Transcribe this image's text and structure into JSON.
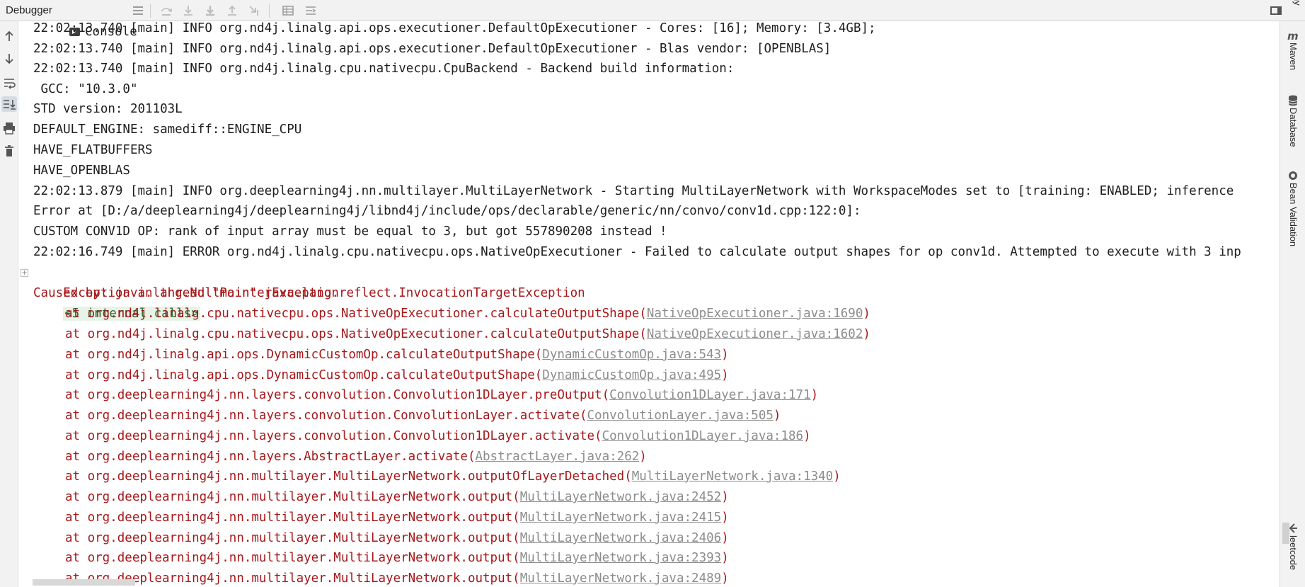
{
  "toolbar": {
    "tabs": [
      {
        "label": "Debugger",
        "icon": "none"
      },
      {
        "label": "Console",
        "icon": "console-icon"
      }
    ],
    "icons": [
      "menu-lines-icon",
      "step-over-icon",
      "step-into-icon",
      "force-step-into-icon",
      "step-out-icon",
      "run-to-cursor-icon",
      "evaluate-table-icon",
      "trace-icon",
      "restore-layout-icon"
    ]
  },
  "left_toolbar": {
    "buttons": [
      "up-arrow-icon",
      "down-arrow-icon",
      "soft-wrap-icon",
      "scroll-to-end-icon",
      "print-icon",
      "trash-icon"
    ],
    "active": "scroll-to-end-icon"
  },
  "right_toolbar": {
    "cut_label": "ny",
    "tabs": [
      {
        "label": "Maven",
        "icon": "maven-icon"
      },
      {
        "label": "Database",
        "icon": "database-icon"
      },
      {
        "label": "Bean Validation",
        "icon": "bean-icon"
      },
      {
        "label": "leetcode",
        "icon": "leetcode-icon"
      }
    ]
  },
  "console": {
    "lines": [
      {
        "type": "info",
        "text": "22:02:13.740 [main] INFO org.nd4j.linalg.api.ops.executioner.DefaultOpExecutioner - Cores: [16]; Memory: [3.4GB];"
      },
      {
        "type": "info",
        "text": "22:02:13.740 [main] INFO org.nd4j.linalg.api.ops.executioner.DefaultOpExecutioner - Blas vendor: [OPENBLAS]"
      },
      {
        "type": "info",
        "text": "22:02:13.740 [main] INFO org.nd4j.linalg.cpu.nativecpu.CpuBackend - Backend build information:"
      },
      {
        "type": "info",
        "text": " GCC: \"10.3.0\""
      },
      {
        "type": "info",
        "text": "STD version: 201103L"
      },
      {
        "type": "info",
        "text": "DEFAULT_ENGINE: samediff::ENGINE_CPU"
      },
      {
        "type": "info",
        "text": "HAVE_FLATBUFFERS"
      },
      {
        "type": "info",
        "text": "HAVE_OPENBLAS"
      },
      {
        "type": "info",
        "text": "22:02:13.879 [main] INFO org.deeplearning4j.nn.multilayer.MultiLayerNetwork - Starting MultiLayerNetwork with WorkspaceModes set to [training: ENABLED; inference"
      },
      {
        "type": "info",
        "text": "Error at [D:/a/deeplearning4j/deeplearning4j/libnd4j/include/ops/declarable/generic/nn/convo/conv1d.cpp:122:0]:"
      },
      {
        "type": "info",
        "text": "CUSTOM CONV1D OP: rank of input array must be equal to 3, but got 557890208 instead !"
      },
      {
        "type": "info",
        "text": "22:02:16.749 [main] ERROR org.nd4j.linalg.cpu.nativecpu.ops.NativeOpExecutioner - Failed to calculate output shapes for op conv1d. Attempted to execute with 3 inp"
      }
    ],
    "exception": {
      "text": "Exception in thread \"main\" java.lang.reflect.InvocationTargetException",
      "badge": "<5 internal calls>",
      "fold": "+"
    },
    "caused_by": "Caused by: java.lang.NullPointerException",
    "stack": [
      {
        "prefix": "at org.nd4j.linalg.cpu.nativecpu.ops.NativeOpExecutioner.calculateOutputShape(",
        "link": "NativeOpExecutioner.java:1690",
        "suffix": ")"
      },
      {
        "prefix": "at org.nd4j.linalg.cpu.nativecpu.ops.NativeOpExecutioner.calculateOutputShape(",
        "link": "NativeOpExecutioner.java:1602",
        "suffix": ")"
      },
      {
        "prefix": "at org.nd4j.linalg.api.ops.DynamicCustomOp.calculateOutputShape(",
        "link": "DynamicCustomOp.java:543",
        "suffix": ")"
      },
      {
        "prefix": "at org.nd4j.linalg.api.ops.DynamicCustomOp.calculateOutputShape(",
        "link": "DynamicCustomOp.java:495",
        "suffix": ")"
      },
      {
        "prefix": "at org.deeplearning4j.nn.layers.convolution.Convolution1DLayer.preOutput(",
        "link": "Convolution1DLayer.java:171",
        "suffix": ")"
      },
      {
        "prefix": "at org.deeplearning4j.nn.layers.convolution.ConvolutionLayer.activate(",
        "link": "ConvolutionLayer.java:505",
        "suffix": ")"
      },
      {
        "prefix": "at org.deeplearning4j.nn.layers.convolution.Convolution1DLayer.activate(",
        "link": "Convolution1DLayer.java:186",
        "suffix": ")"
      },
      {
        "prefix": "at org.deeplearning4j.nn.layers.AbstractLayer.activate(",
        "link": "AbstractLayer.java:262",
        "suffix": ")"
      },
      {
        "prefix": "at org.deeplearning4j.nn.multilayer.MultiLayerNetwork.outputOfLayerDetached(",
        "link": "MultiLayerNetwork.java:1340",
        "suffix": ")"
      },
      {
        "prefix": "at org.deeplearning4j.nn.multilayer.MultiLayerNetwork.output(",
        "link": "MultiLayerNetwork.java:2452",
        "suffix": ")"
      },
      {
        "prefix": "at org.deeplearning4j.nn.multilayer.MultiLayerNetwork.output(",
        "link": "MultiLayerNetwork.java:2415",
        "suffix": ")"
      },
      {
        "prefix": "at org.deeplearning4j.nn.multilayer.MultiLayerNetwork.output(",
        "link": "MultiLayerNetwork.java:2406",
        "suffix": ")"
      },
      {
        "prefix": "at org.deeplearning4j.nn.multilayer.MultiLayerNetwork.output(",
        "link": "MultiLayerNetwork.java:2393",
        "suffix": ")"
      },
      {
        "prefix": "at org.deeplearning4j.nn.multilayer.MultiLayerNetwork.output(",
        "link": "MultiLayerNetwork.java:2489",
        "suffix": ")"
      }
    ]
  },
  "colors": {
    "error_text": "#a6181a",
    "link_text": "#8c8c8c",
    "badge_bg": "#e6f3e6",
    "badge_text": "#2f6b2f",
    "toolbar_bg": "#f2f2f2"
  }
}
